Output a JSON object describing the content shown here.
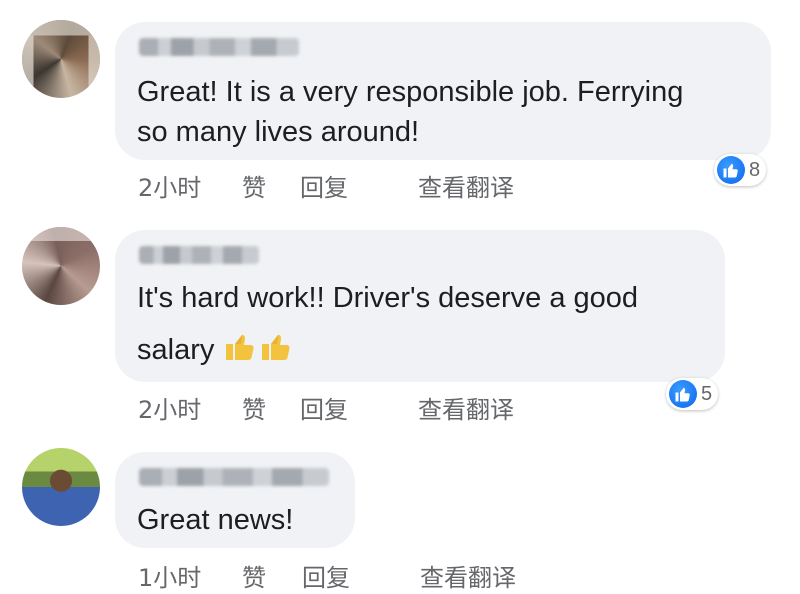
{
  "comments": [
    {
      "text_lines": [
        "Great! It is a very responsible job. Ferrying",
        "so many lives around!"
      ],
      "time": "2小时",
      "like_label": "赞",
      "reply_label": "回复",
      "translate_label": "查看翻译",
      "reaction_count": "8",
      "reaction_icon": "thumbs-up-icon"
    },
    {
      "text_lines": [
        "It's hard work!! Driver's deserve a good",
        "salary"
      ],
      "emoji": [
        "thumbs-up-emoji",
        "thumbs-up-emoji"
      ],
      "time": "2小时",
      "like_label": "赞",
      "reply_label": "回复",
      "translate_label": "查看翻译",
      "reaction_count": "5",
      "reaction_icon": "thumbs-up-icon"
    },
    {
      "text_lines": [
        "Great news!"
      ],
      "time": "1小时",
      "like_label": "赞",
      "reply_label": "回复",
      "translate_label": "查看翻译"
    }
  ],
  "colors": {
    "bubble": "#f0f2f5",
    "meta_text": "#65676b",
    "like_blue": "#1877f2"
  }
}
